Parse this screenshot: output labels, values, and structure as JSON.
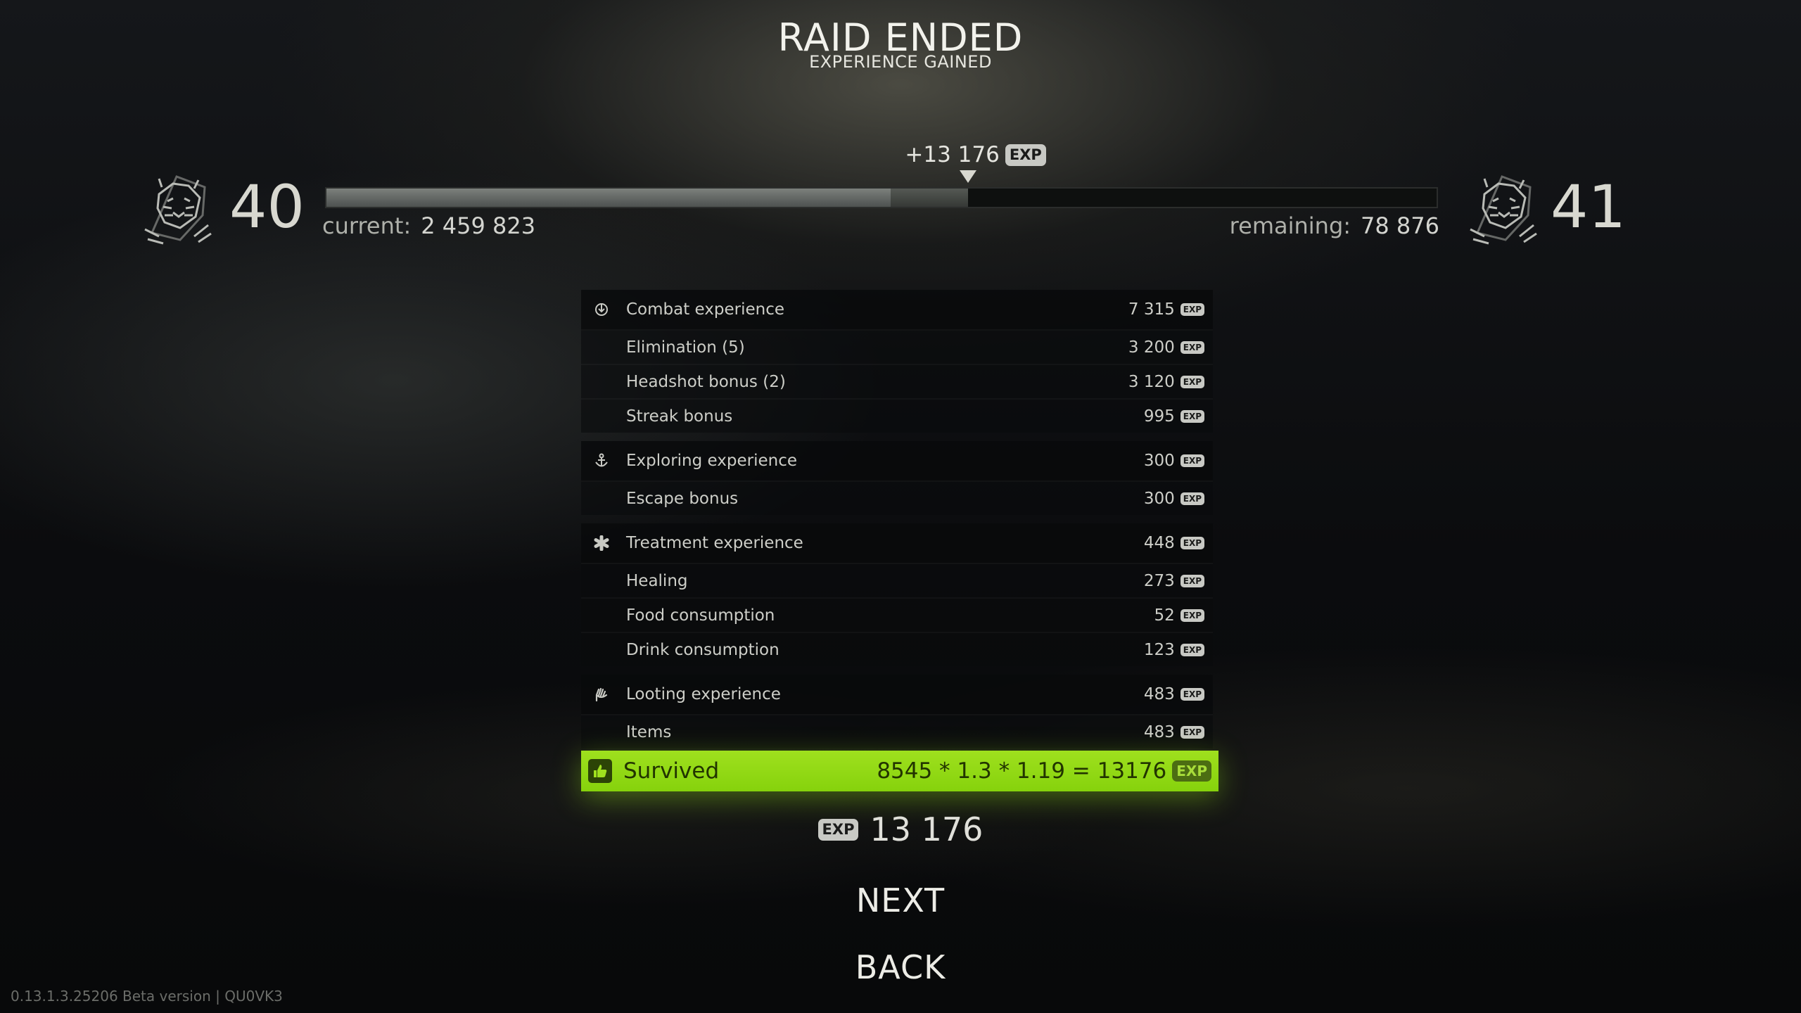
{
  "header": {
    "title": "RAID ENDED",
    "subtitle": "EXPERIENCE GAINED"
  },
  "level": {
    "current_level": "40",
    "next_level": "41",
    "gain_label": "+13 176",
    "exp_badge": "EXP",
    "current_label": "current:",
    "current_value": "2 459 823",
    "remaining_label": "remaining:",
    "remaining_value": "78 876",
    "progress_before_fraction": 0.508,
    "progress_after_fraction": 0.578,
    "level_icon": "tiger-head-icon"
  },
  "groups": [
    {
      "icon": "crosshair-icon",
      "title": "Combat experience",
      "value": "7 315",
      "rows": [
        {
          "label": "Elimination (5)",
          "value": "3 200"
        },
        {
          "label": "Headshot bonus (2)",
          "value": "3 120"
        },
        {
          "label": "Streak bonus",
          "value": "995"
        }
      ]
    },
    {
      "icon": "anchor-icon",
      "title": "Exploring experience",
      "value": "300",
      "rows": [
        {
          "label": "Escape bonus",
          "value": "300"
        }
      ]
    },
    {
      "icon": "medical-icon",
      "title": "Treatment experience",
      "value": "448",
      "rows": [
        {
          "label": "Healing",
          "value": "273"
        },
        {
          "label": "Food consumption",
          "value": "52"
        },
        {
          "label": "Drink consumption",
          "value": "123"
        }
      ]
    },
    {
      "icon": "hand-icon",
      "title": "Looting experience",
      "value": "483",
      "rows": [
        {
          "label": "Items",
          "value": "483"
        }
      ]
    }
  ],
  "survived": {
    "label": "Survived",
    "formula": "8545 * 1.3 * 1.19 = 13176",
    "icon": "thumbs-up-icon",
    "accent_color": "#9fe01e"
  },
  "total": {
    "value": "13 176"
  },
  "buttons": {
    "next": "NEXT",
    "back": "BACK"
  },
  "footer": {
    "version": "0.13.1.3.25206 Beta version | QU0VK3"
  }
}
